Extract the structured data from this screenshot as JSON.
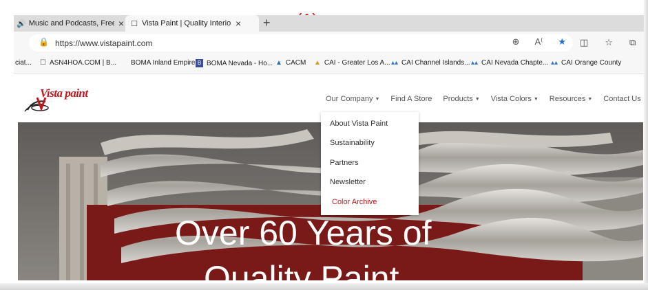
{
  "annotation": "(1)",
  "browser": {
    "tabs": [
      {
        "icon": "speaker-icon",
        "title": "Music and Podcasts, Free a"
      },
      {
        "icon": "page-icon",
        "title": "Vista Paint | Quality Interior & Ex",
        "active": true
      }
    ],
    "new_tab_symbol": "+",
    "url": "https://www.vistapaint.com",
    "bookmarks": [
      {
        "label": "ciat...",
        "icon": ""
      },
      {
        "label": "ASN4HOA.COM | B...",
        "icon": "page-icon"
      },
      {
        "label": "BOMA Inland Empire",
        "icon": ""
      },
      {
        "label": "BOMA Nevada - Ho...",
        "icon": "boma-icon"
      },
      {
        "label": "CACM",
        "icon": "cacm-icon"
      },
      {
        "label": "CAI - Greater Los A...",
        "icon": "cai-icon"
      },
      {
        "label": "CAI Channel Islands...",
        "icon": "cai-icon"
      },
      {
        "label": "CAI Nevada Chapte...",
        "icon": "cai-icon"
      },
      {
        "label": "CAI Orange County",
        "icon": "cai-icon"
      }
    ]
  },
  "site": {
    "logo_text": "Vista paint",
    "nav": {
      "our_company": "Our Company",
      "find_store": "Find A Store",
      "products": "Products",
      "vista_colors": "Vista Colors",
      "resources": "Resources",
      "contact": "Contact Us"
    },
    "dropdown": [
      "About Vista Paint",
      "Sustainability",
      "Partners",
      "Newsletter",
      "Color Archive"
    ],
    "hero": {
      "line1": "Over 60 Years of",
      "line2": "Quality Paint"
    }
  },
  "colors": {
    "brand_red": "#c4161c",
    "annotation_red": "#e0201c",
    "star_blue": "#1a6fd8"
  }
}
